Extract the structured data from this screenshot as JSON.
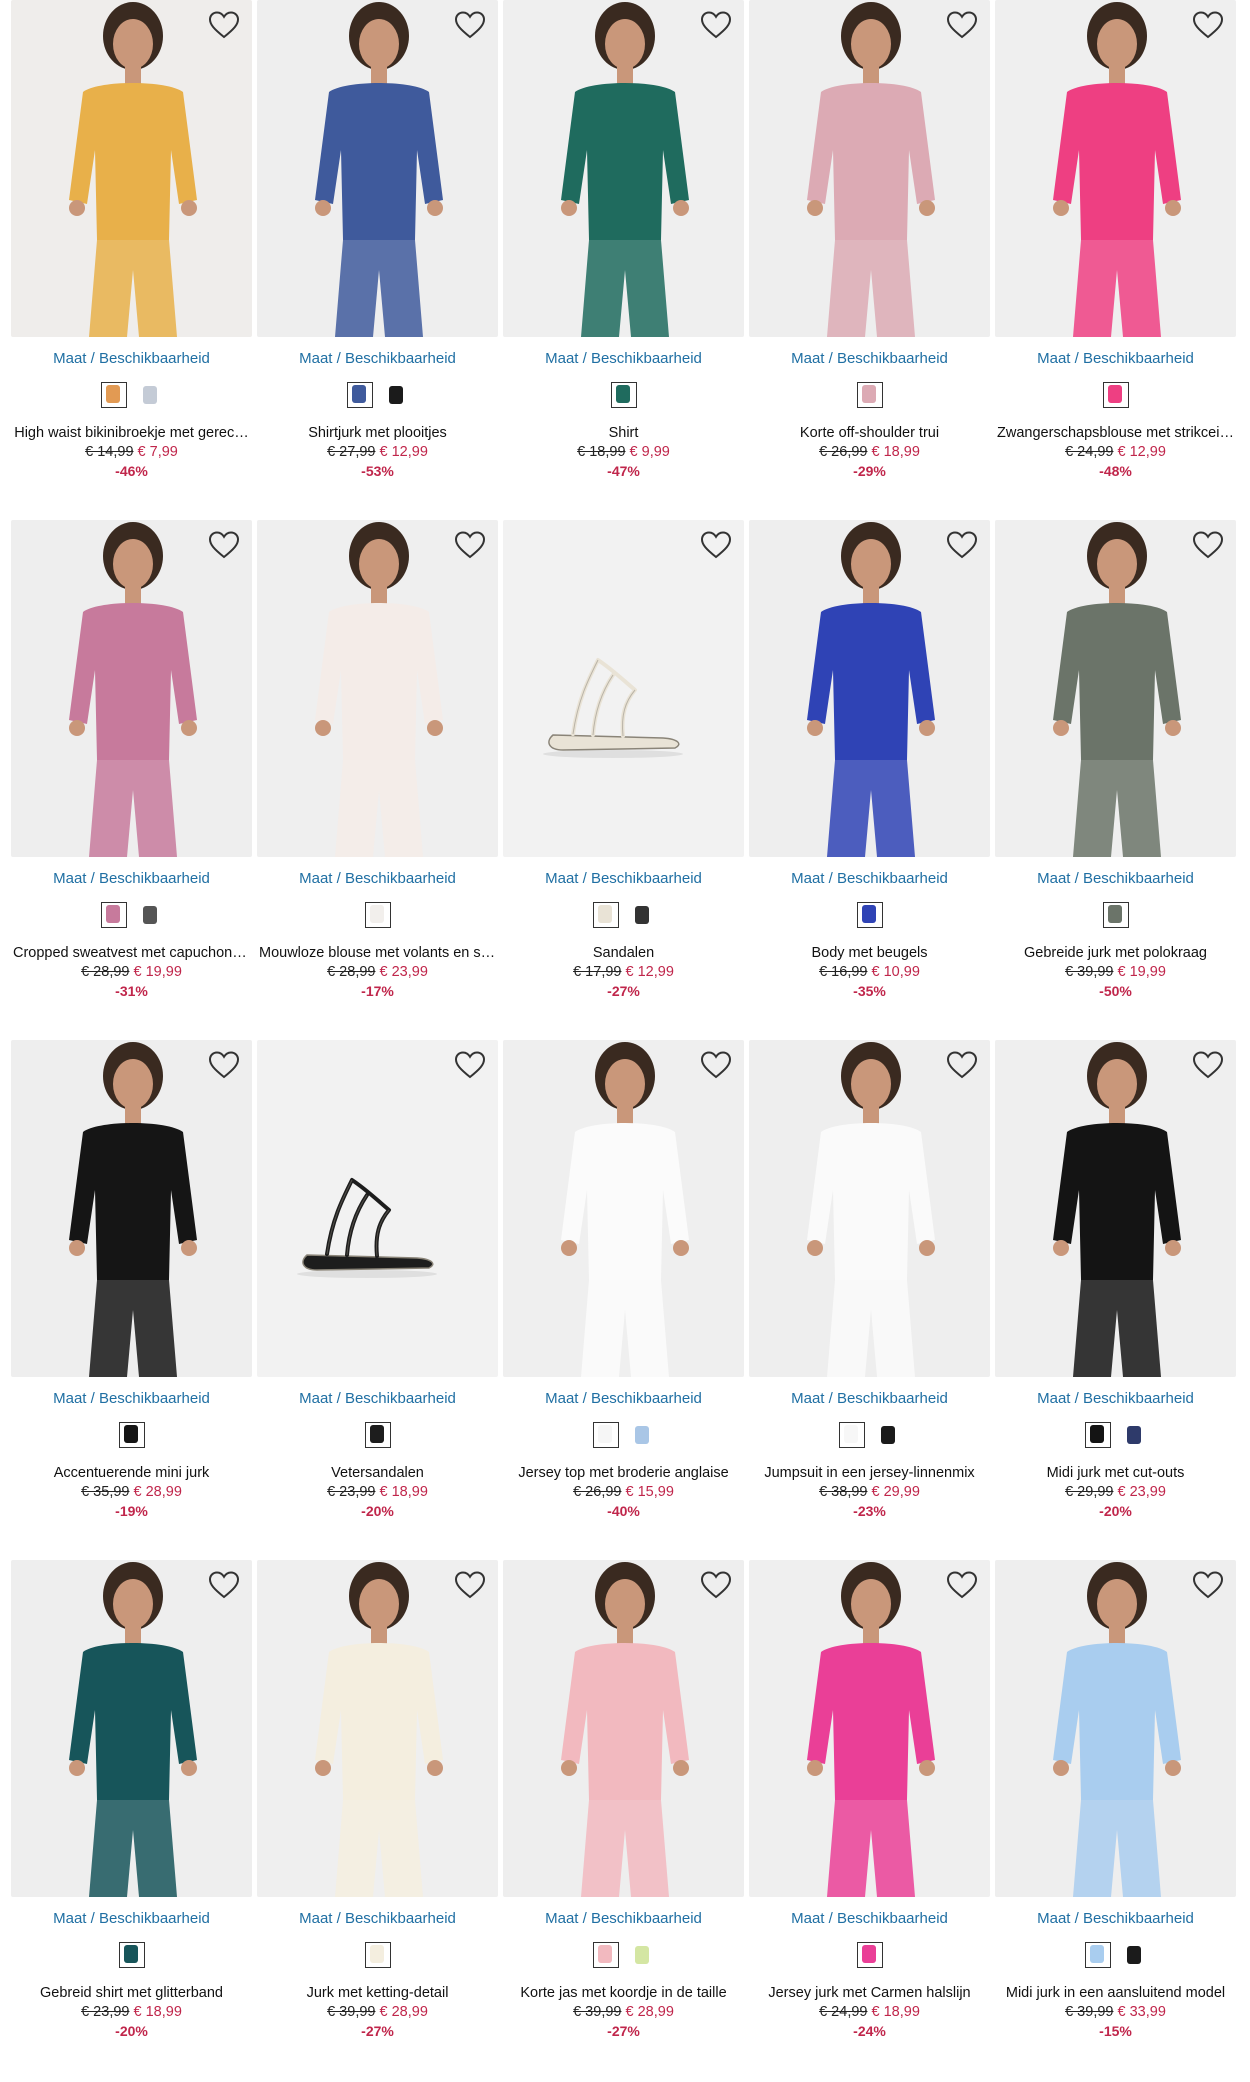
{
  "common": {
    "maat_label": "Maat / Beschikbaarheid",
    "wishlist_icon": "heart-icon",
    "colors": {
      "link": "#1f6fa3",
      "sale": "#c0264b",
      "old_price": "#222222"
    }
  },
  "products": [
    {
      "name": "High waist bikinibroekje met gerec…",
      "old_price": "€ 14,99",
      "new_price": "€ 7,99",
      "discount": "-46%",
      "bg": "#efedeb",
      "garment": "#e8b04a",
      "swatches": [
        "#e29a53",
        "#c4cbd6"
      ]
    },
    {
      "name": "Shirtjurk met plooitjes",
      "old_price": "€ 27,99",
      "new_price": "€ 12,99",
      "discount": "-53%",
      "bg": "#eeeeee",
      "garment": "#3f5a9c",
      "swatches": [
        "#3f5a9c",
        "#1b1b1b"
      ]
    },
    {
      "name": "Shirt",
      "old_price": "€ 18,99",
      "new_price": "€ 9,99",
      "discount": "-47%",
      "bg": "#efefef",
      "garment": "#1f6b5e",
      "swatches": [
        "#1f6b5e"
      ]
    },
    {
      "name": "Korte off-shoulder trui",
      "old_price": "€ 26,99",
      "new_price": "€ 18,99",
      "discount": "-29%",
      "bg": "#eeeeee",
      "garment": "#dcaab4",
      "swatches": [
        "#dcaab4"
      ]
    },
    {
      "name": "Zwangerschapsblouse met strikcei…",
      "old_price": "€ 24,99",
      "new_price": "€ 12,99",
      "discount": "-48%",
      "bg": "#efefef",
      "garment": "#ee3f82",
      "swatches": [
        "#ee3f82"
      ]
    },
    {
      "name": "Cropped sweatvest met capuchon i…",
      "old_price": "€ 28,99",
      "new_price": "€ 19,99",
      "discount": "-31%",
      "bg": "#eeeeee",
      "garment": "#c77a9c",
      "swatches": [
        "#c77a9c",
        "#555555"
      ]
    },
    {
      "name": "Mouwloze blouse met volants en st…",
      "old_price": "€ 28,99",
      "new_price": "€ 23,99",
      "discount": "-17%",
      "bg": "#efefef",
      "garment": "#f4ece8",
      "swatches": [
        "#f2efec"
      ]
    },
    {
      "name": "Sandalen",
      "old_price": "€ 17,99",
      "new_price": "€ 12,99",
      "discount": "-27%",
      "bg": "#f2f2f2",
      "garment": "#e9e3d6",
      "swatches": [
        "#e9e3d6",
        "#333333"
      ]
    },
    {
      "name": "Body met beugels",
      "old_price": "€ 16,99",
      "new_price": "€ 10,99",
      "discount": "-35%",
      "bg": "#eeeeee",
      "garment": "#2f43b5",
      "swatches": [
        "#2f43b5"
      ]
    },
    {
      "name": "Gebreide jurk met polokraag",
      "old_price": "€ 39,99",
      "new_price": "€ 19,99",
      "discount": "-50%",
      "bg": "#efefef",
      "garment": "#6b7469",
      "swatches": [
        "#6b7469"
      ]
    },
    {
      "name": "Accentuerende mini jurk",
      "old_price": "€ 35,99",
      "new_price": "€ 28,99",
      "discount": "-19%",
      "bg": "#eeeeee",
      "garment": "#151515",
      "swatches": [
        "#151515"
      ]
    },
    {
      "name": "Vetersandalen",
      "old_price": "€ 23,99",
      "new_price": "€ 18,99",
      "discount": "-20%",
      "bg": "#f2f2f2",
      "garment": "#1d1d1d",
      "swatches": [
        "#1d1d1d"
      ]
    },
    {
      "name": "Jersey top met broderie anglaise",
      "old_price": "€ 26,99",
      "new_price": "€ 15,99",
      "discount": "-40%",
      "bg": "#efefef",
      "garment": "#fbfbfb",
      "swatches": [
        "#f6f6f6",
        "#a9c6e6"
      ]
    },
    {
      "name": "Jumpsuit in een jersey-linnenmix",
      "old_price": "€ 38,99",
      "new_price": "€ 29,99",
      "discount": "-23%",
      "bg": "#eeeeee",
      "garment": "#fafafa",
      "swatches": [
        "#f7f7f7",
        "#1b1b1b"
      ]
    },
    {
      "name": "Midi jurk met cut-outs",
      "old_price": "€ 29,99",
      "new_price": "€ 23,99",
      "discount": "-20%",
      "bg": "#efefef",
      "garment": "#141414",
      "swatches": [
        "#141414",
        "#2e3a6a"
      ]
    },
    {
      "name": "Gebreid shirt met glitterband",
      "old_price": "€ 23,99",
      "new_price": "€ 18,99",
      "discount": "-20%",
      "bg": "#eeeeee",
      "garment": "#17555a",
      "swatches": [
        "#17555a"
      ]
    },
    {
      "name": "Jurk met ketting-detail",
      "old_price": "€ 39,99",
      "new_price": "€ 28,99",
      "discount": "-27%",
      "bg": "#efefef",
      "garment": "#f4eedf",
      "swatches": [
        "#f4eedf"
      ]
    },
    {
      "name": "Korte jas met koordje in de taille",
      "old_price": "€ 39,99",
      "new_price": "€ 28,99",
      "discount": "-27%",
      "bg": "#eeeeee",
      "garment": "#f2b9bf",
      "swatches": [
        "#f2b9bf",
        "#d4e6a3"
      ]
    },
    {
      "name": "Jersey jurk met Carmen halslijn",
      "old_price": "€ 24,99",
      "new_price": "€ 18,99",
      "discount": "-24%",
      "bg": "#efefef",
      "garment": "#ea3f97",
      "swatches": [
        "#ea3f97"
      ]
    },
    {
      "name": "Midi jurk in een aansluitend model",
      "old_price": "€ 39,99",
      "new_price": "€ 33,99",
      "discount": "-15%",
      "bg": "#eeeeee",
      "garment": "#a9cdef",
      "swatches": [
        "#a9cdef",
        "#1b1b1b"
      ]
    }
  ]
}
